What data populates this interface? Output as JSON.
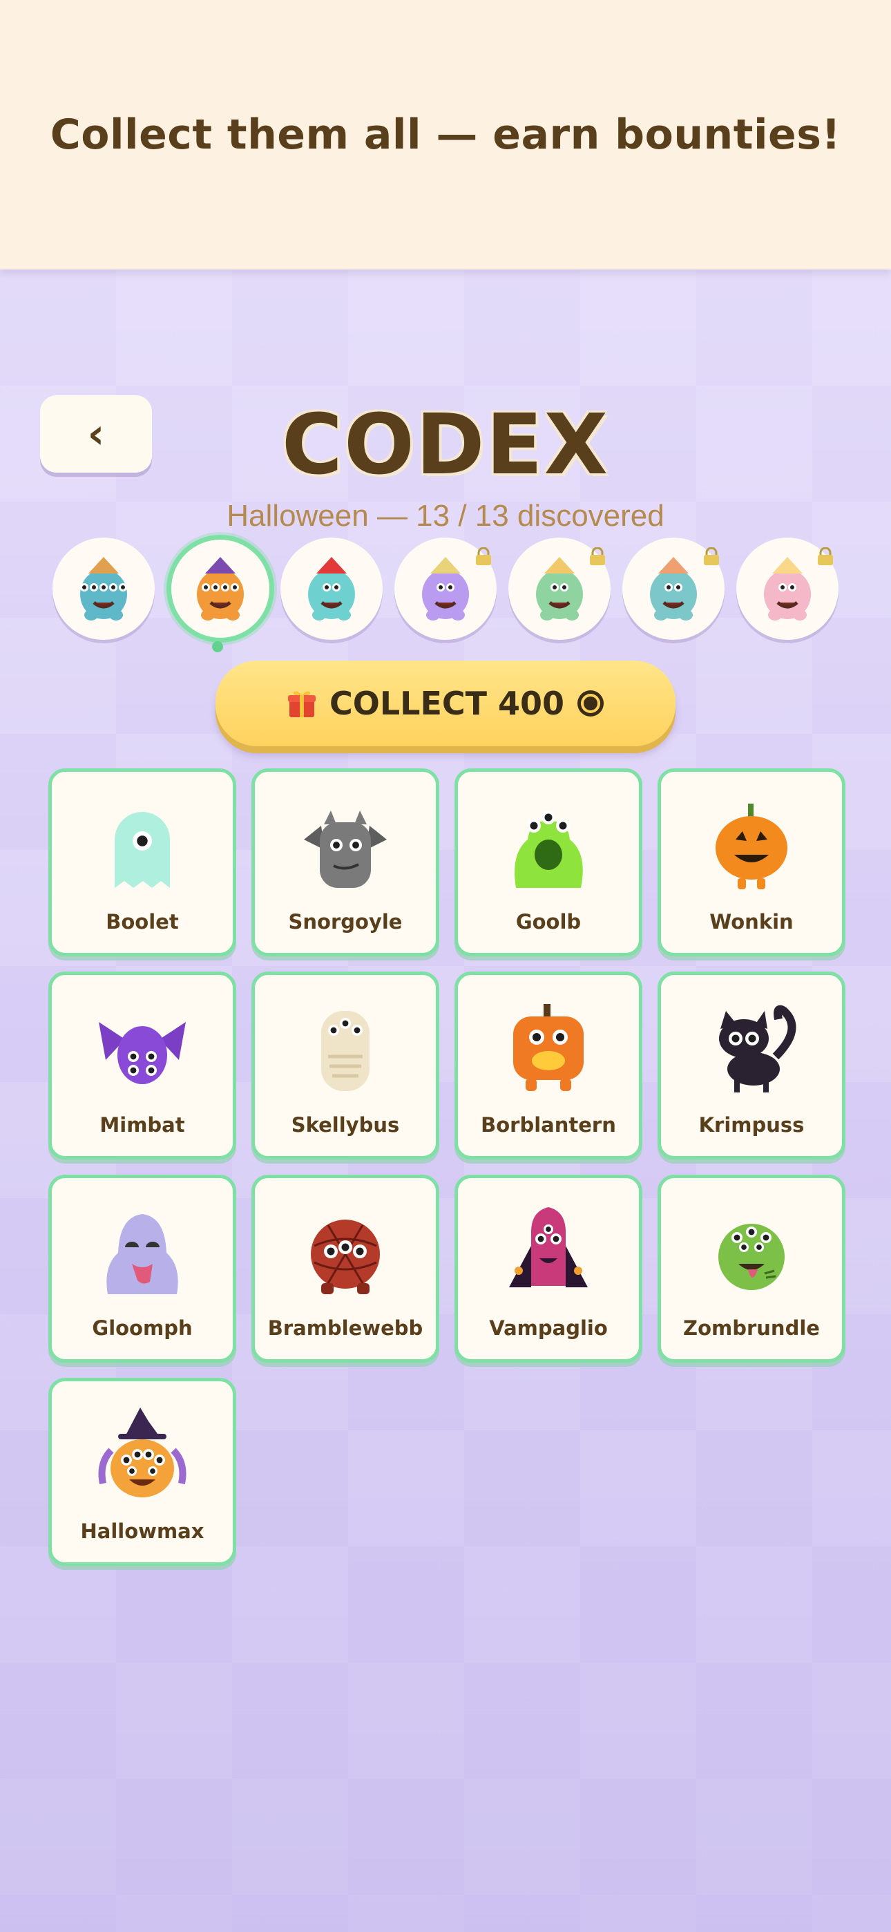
{
  "banner": {
    "text": "Collect them all — earn bounties!"
  },
  "header": {
    "back_label": "‹",
    "title": "CODEX",
    "subtitle": "Halloween — 13 / 13 discovered"
  },
  "sets": [
    {
      "name": "set-1",
      "locked": false,
      "active": false,
      "body": "#5fb8c8",
      "accent": "#e0a050"
    },
    {
      "name": "set-2",
      "locked": false,
      "active": true,
      "body": "#f29a3a",
      "accent": "#7b4bb0"
    },
    {
      "name": "set-3",
      "locked": false,
      "active": false,
      "body": "#6fd0d0",
      "accent": "#e23a3a"
    },
    {
      "name": "set-4",
      "locked": true,
      "active": false,
      "body": "#b99cf0",
      "accent": "#e8d27a"
    },
    {
      "name": "set-5",
      "locked": true,
      "active": false,
      "body": "#8fd4a0",
      "accent": "#f1c86a"
    },
    {
      "name": "set-6",
      "locked": true,
      "active": false,
      "body": "#7cc7c9",
      "accent": "#f0a070"
    },
    {
      "name": "set-7",
      "locked": true,
      "active": false,
      "body": "#f4b8c8",
      "accent": "#f9d88a"
    }
  ],
  "collect": {
    "label": "COLLECT 400"
  },
  "monsters": [
    {
      "name": "Boolet",
      "body": "#aef0dd",
      "shape": "ghost"
    },
    {
      "name": "Snorgoyle",
      "body": "#7a7a7a",
      "shape": "gargoyle"
    },
    {
      "name": "Goolb",
      "body": "#8ee43c",
      "shape": "blob"
    },
    {
      "name": "Wonkin",
      "body": "#f28a1e",
      "shape": "pumpkin"
    },
    {
      "name": "Mimbat",
      "body": "#8a4ad8",
      "shape": "bat"
    },
    {
      "name": "Skellybus",
      "body": "#f0e4c8",
      "shape": "skeleton"
    },
    {
      "name": "Borblantern",
      "body": "#f07a24",
      "shape": "lantern"
    },
    {
      "name": "Krimpuss",
      "body": "#2a2230",
      "shape": "cat"
    },
    {
      "name": "Gloomph",
      "body": "#b8b0e8",
      "shape": "ghoul"
    },
    {
      "name": "Bramblewebb",
      "body": "#b43a2a",
      "shape": "spider"
    },
    {
      "name": "Vampaglio",
      "body": "#c83a7a",
      "shape": "vampire"
    },
    {
      "name": "Zombrundle",
      "body": "#7cc048",
      "shape": "zombie"
    },
    {
      "name": "Hallowmax",
      "body": "#f4a23a",
      "shape": "witch"
    }
  ],
  "colors": {
    "card_border": "#7fe0a6",
    "text_brown": "#5a3f1c",
    "collect_yellow": "#ffd25e"
  }
}
